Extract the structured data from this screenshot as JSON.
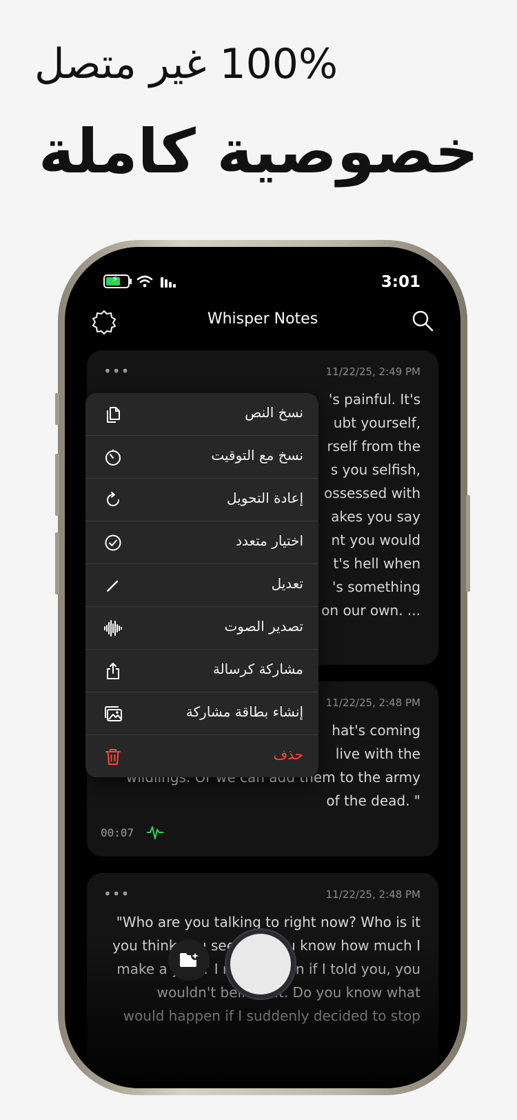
{
  "headline": {
    "line1": "100% غير متصل",
    "line2": "خصوصية كاملة"
  },
  "status_bar": {
    "time": "3:01"
  },
  "nav": {
    "title": "Whisper Notes"
  },
  "notes": [
    {
      "dots": "•••",
      "date": "11/22/25, 2:49 PM",
      "visible_text": "'s painful. It's\nubt yourself,\nrself from the\ns you selfish,\nossessed with\nakes you say\nnt you would\nt's hell when\n's something\n on our own. ..."
    },
    {
      "dots": "•••",
      "date": "11/22/25, 2:48 PM",
      "visible_text": "hat's coming\nlive with the\nwildlings. Or we can add them to the army\nof the dead. \"",
      "duration": "00:07"
    },
    {
      "dots": "•••",
      "date": "11/22/25, 2:48 PM",
      "visible_text": "\"Who are you talking to right now? Who is it\nyou think you see? Do you know how much I\nmake a year? I mean, even if I told you, you\nwouldn't believe it. Do you know what\nwould happen if I suddenly decided to stop"
    }
  ],
  "context_menu": {
    "items": [
      {
        "label": "نسخ النص",
        "icon": "copy-icon"
      },
      {
        "label": "نسخ مع التوقيت",
        "icon": "timer-icon"
      },
      {
        "label": "إعادة التحويل",
        "icon": "refresh-icon"
      },
      {
        "label": "اختيار متعدد",
        "icon": "checkmark-circle-icon"
      },
      {
        "label": "تعديل",
        "icon": "pencil-icon"
      },
      {
        "label": "تصدير الصوت",
        "icon": "waveform-icon"
      },
      {
        "label": "مشاركة كرسالة",
        "icon": "share-icon"
      },
      {
        "label": "إنشاء بطاقة مشاركة",
        "icon": "photo-stack-icon"
      },
      {
        "label": "حذف",
        "icon": "trash-icon"
      }
    ]
  },
  "colors": {
    "accent_green": "#30d158",
    "danger_red": "#ff453a",
    "menu_bg": "#272727",
    "card_bg": "#141414"
  }
}
